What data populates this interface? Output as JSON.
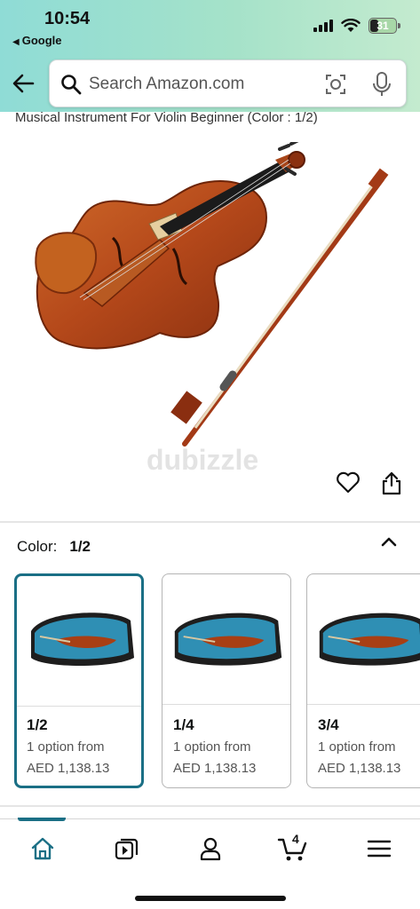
{
  "status_bar": {
    "time": "10:54",
    "back_app": "Google",
    "battery": "31"
  },
  "search": {
    "placeholder": "Search Amazon.com"
  },
  "product": {
    "title": "Musical Instrument For Violin Beginner (Color : 1/2)",
    "watermark": "dubizzle"
  },
  "color_selector": {
    "label": "Color:",
    "selected": "1/2",
    "options": [
      {
        "size": "1/2",
        "availability": "1 option from",
        "price": "AED 1,138.13"
      },
      {
        "size": "1/4",
        "availability": "1 option from",
        "price": "AED 1,138.13"
      },
      {
        "size": "3/4",
        "availability": "1 option from",
        "price": "AED 1,138.13"
      }
    ]
  },
  "bottom_nav": {
    "items": [
      "home-icon",
      "video-icon",
      "account-icon",
      "cart-icon",
      "menu-icon"
    ],
    "cart_count": "4",
    "active": "home"
  },
  "colors": {
    "accent": "#1a6f85",
    "header_gradient_start": "#8fdcd6",
    "header_gradient_end": "#c4ebcf"
  }
}
